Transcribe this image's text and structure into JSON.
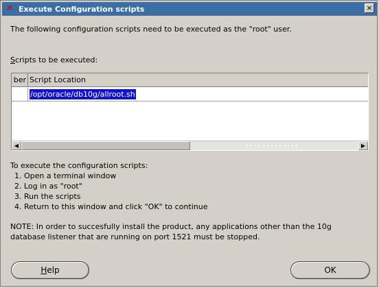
{
  "window": {
    "title": "Execute Configuration scripts",
    "close_glyph": "×"
  },
  "intro_text": "The following configuration scripts need to be executed as the \"root\" user.",
  "scripts_label": {
    "mnemonic": "S",
    "rest": "cripts to be executed:"
  },
  "table": {
    "columns": [
      "ber",
      "Script Location"
    ],
    "rows": [
      {
        "number": "",
        "location": "/opt/oracle/db10g/allroot.sh"
      }
    ]
  },
  "instructions": {
    "heading": "To execute the configuration scripts:",
    "steps": [
      "Open a terminal window",
      "Log in as \"root\"",
      "Run the scripts",
      "Return to this window and click \"OK\" to continue"
    ]
  },
  "note": "NOTE: In order to succesfully install the product, any applications other than the 10g database listener that are running on port 1521 must be stopped.",
  "buttons": {
    "help": {
      "mnemonic": "H",
      "rest": "elp"
    },
    "ok": "OK"
  }
}
